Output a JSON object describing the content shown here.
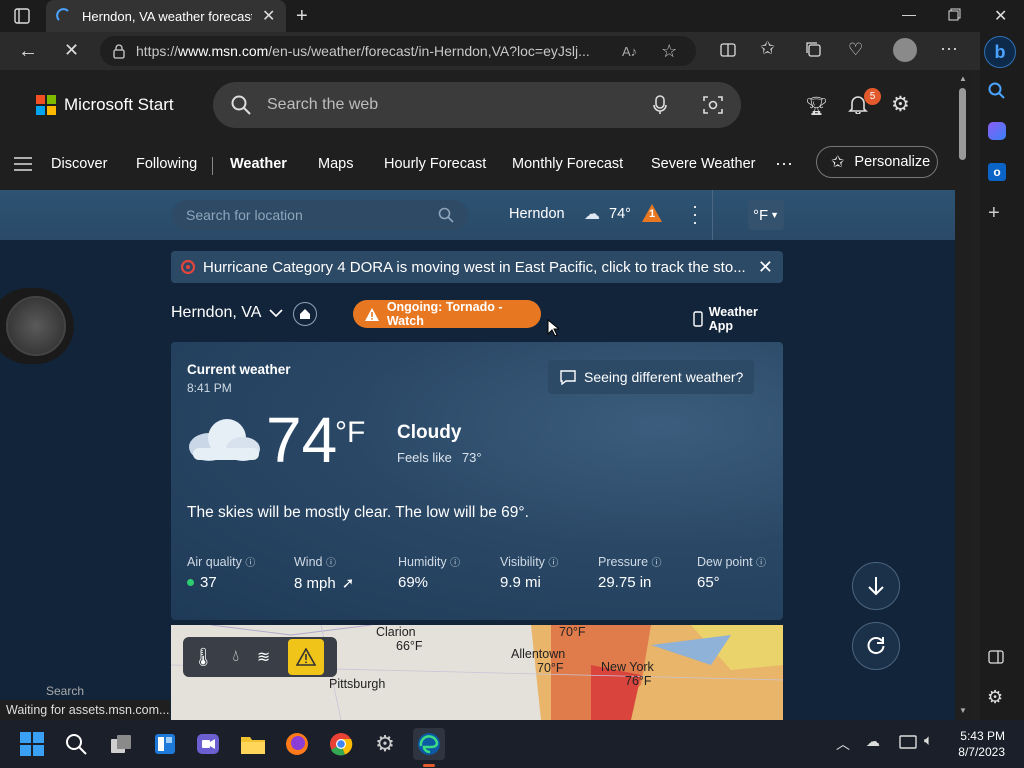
{
  "browser": {
    "tab_title": "Herndon, VA weather forecast | M",
    "url_prefix": "https://",
    "url_host": "www.msn.com",
    "url_path": "/en-us/weather/forecast/in-Herndon,VA?loc=eyJslj...",
    "status_text": "Waiting for assets.msn.com..."
  },
  "msn": {
    "brand": "Microsoft Start",
    "search_placeholder": "Search the web",
    "notification_count": "5",
    "nav": [
      "Discover",
      "Following",
      "Weather",
      "Maps",
      "Hourly Forecast",
      "Monthly Forecast",
      "Severe Weather"
    ],
    "more": "···",
    "personalize": "Personalize"
  },
  "weather_bar": {
    "location_placeholder": "Search for location",
    "city": "Herndon",
    "temp": "74°",
    "alert_count": "1",
    "unit": "°F"
  },
  "alert_banner": "Hurricane Category 4 DORA is moving west in East Pacific, click to track the sto...",
  "location": {
    "name": "Herndon, VA",
    "tornado": "Ongoing: Tornado - Watch",
    "weather_app": "Weather App"
  },
  "current": {
    "heading": "Current weather",
    "time": "8:41 PM",
    "temp": "74",
    "unit": "°F",
    "condition": "Cloudy",
    "feels_label": "Feels like",
    "feels_value": "73°",
    "different": "Seeing different weather?",
    "summary": "The skies will be mostly clear. The low will be 69°.",
    "metrics": [
      {
        "label": "Air quality",
        "value": "37"
      },
      {
        "label": "Wind",
        "value": "8 mph"
      },
      {
        "label": "Humidity",
        "value": "69%"
      },
      {
        "label": "Visibility",
        "value": "9.9 mi"
      },
      {
        "label": "Pressure",
        "value": "29.75 in"
      },
      {
        "label": "Dew point",
        "value": "65°"
      }
    ]
  },
  "map": {
    "cities": [
      {
        "name": "Clarion",
        "temp": "66°F"
      },
      {
        "name": "Allentown",
        "temp": "70°F"
      },
      {
        "name": "New York",
        "temp": "76°F"
      },
      {
        "name": "Pittsburgh",
        "temp": ""
      },
      {
        "name": "",
        "temp": "70°F"
      }
    ],
    "search_label": "Search"
  },
  "taskbar": {
    "time": "5:43 PM",
    "date": "8/7/2023"
  },
  "colors": {
    "accent_orange": "#e87722",
    "aqi_green": "#2ecc71"
  }
}
